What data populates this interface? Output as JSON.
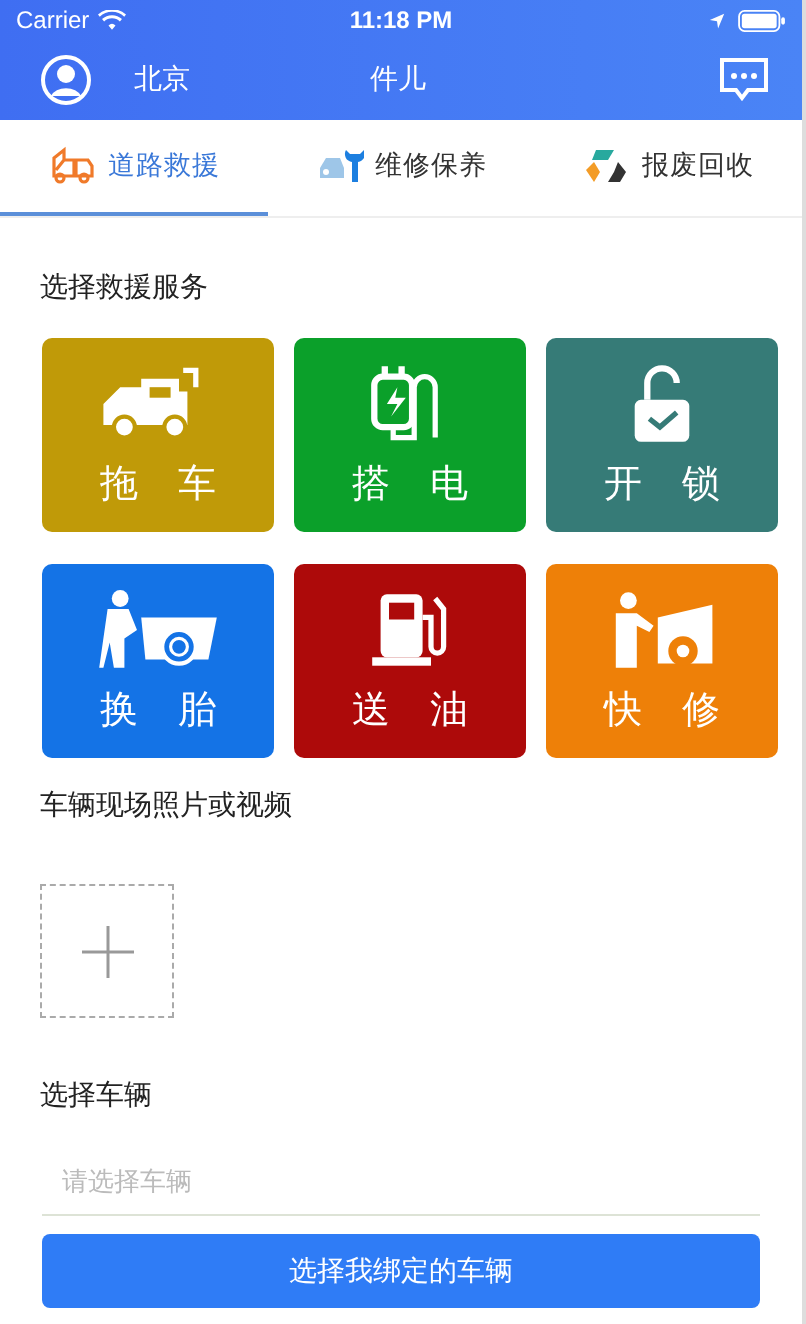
{
  "status_bar": {
    "carrier": "Carrier",
    "time": "11:18 PM"
  },
  "nav": {
    "city": "北京",
    "title": "件儿"
  },
  "tabs": [
    {
      "label": "道路救援",
      "kind": "rescue",
      "selected": true
    },
    {
      "label": "维修保养",
      "kind": "maintain",
      "selected": false
    },
    {
      "label": "报废回收",
      "kind": "recycle",
      "selected": false
    }
  ],
  "services_title": "选择救援服务",
  "services": [
    {
      "label": "拖 车",
      "kind": "tow",
      "color": "#c09a08"
    },
    {
      "label": "搭 电",
      "kind": "charge",
      "color": "#0ba02a"
    },
    {
      "label": "开 锁",
      "kind": "unlock",
      "color": "#367b77"
    },
    {
      "label": "换 胎",
      "kind": "tire",
      "color": "#1473e6"
    },
    {
      "label": "送 油",
      "kind": "fuel",
      "color": "#ad0a0a"
    },
    {
      "label": "快 修",
      "kind": "repair",
      "color": "#ee8008"
    }
  ],
  "media_title": "车辆现场照片或视频",
  "vehicle_title": "选择车辆",
  "vehicle_field": {
    "placeholder": "请选择车辆"
  },
  "bind_button": "选择我绑定的车辆"
}
